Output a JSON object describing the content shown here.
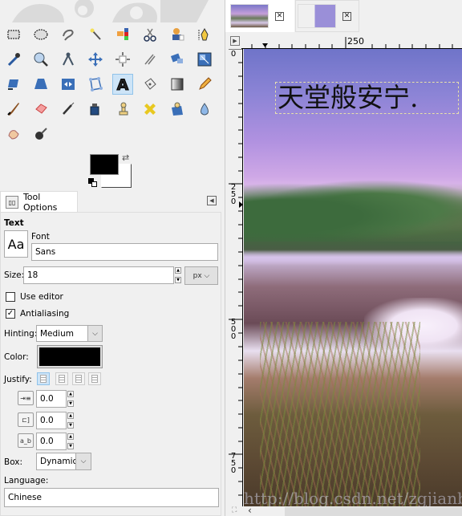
{
  "toolbox": {
    "tools": [
      {
        "name": "rect-select",
        "active": false
      },
      {
        "name": "ellipse-select",
        "active": false
      },
      {
        "name": "free-select",
        "active": false
      },
      {
        "name": "fuzzy-select",
        "active": false
      },
      {
        "name": "select-by-color",
        "active": false
      },
      {
        "name": "scissors-select",
        "active": false
      },
      {
        "name": "foreground-select",
        "active": false
      },
      {
        "name": "paths",
        "active": false
      },
      {
        "name": "color-picker",
        "active": false
      },
      {
        "name": "zoom",
        "active": false
      },
      {
        "name": "measure",
        "active": false
      },
      {
        "name": "move",
        "active": false
      },
      {
        "name": "alignment",
        "active": false
      },
      {
        "name": "crop",
        "active": false
      },
      {
        "name": "rotate",
        "active": false
      },
      {
        "name": "scale",
        "active": false
      },
      {
        "name": "shear",
        "active": false
      },
      {
        "name": "perspective",
        "active": false
      },
      {
        "name": "flip",
        "active": false
      },
      {
        "name": "cage-transform",
        "active": false
      },
      {
        "name": "text",
        "active": true
      },
      {
        "name": "bucket-fill",
        "active": false
      },
      {
        "name": "blend",
        "active": false
      },
      {
        "name": "pencil",
        "active": false
      },
      {
        "name": "paintbrush",
        "active": false
      },
      {
        "name": "eraser",
        "active": false
      },
      {
        "name": "airbrush",
        "active": false
      },
      {
        "name": "ink",
        "active": false
      },
      {
        "name": "clone",
        "active": false
      },
      {
        "name": "heal",
        "active": false
      },
      {
        "name": "perspective-clone",
        "active": false
      },
      {
        "name": "blur-sharpen",
        "active": false
      },
      {
        "name": "smudge",
        "active": false
      },
      {
        "name": "dodge-burn",
        "active": false
      }
    ],
    "foreground_color": "#000000",
    "background_color": "#ffffff"
  },
  "tool_options": {
    "tab_label": "Tool Options",
    "section_title": "Text",
    "font_label": "Font",
    "font_preview": "Aa",
    "font_value": "Sans",
    "size_label": "Size:",
    "size_value": "18",
    "size_unit": "px",
    "use_editor_label": "Use editor",
    "use_editor_checked": false,
    "antialiasing_label": "Antialiasing",
    "antialiasing_checked": true,
    "hinting_label": "Hinting:",
    "hinting_value": "Medium",
    "color_label": "Color:",
    "color_value": "#000000",
    "justify_label": "Justify:",
    "justify_selected": "left",
    "indent_value": "0.0",
    "line_spacing_value": "0.0",
    "letter_spacing_value": "0.0",
    "letter_spacing_icon": "a_b",
    "box_label": "Box:",
    "box_value": "Dynamic",
    "language_label": "Language:",
    "language_value": "Chinese"
  },
  "image_window": {
    "tabs": [
      {
        "name": "lake-image",
        "active": true
      },
      {
        "name": "screenshot-image",
        "active": false
      }
    ],
    "hruler_label": "250",
    "vruler_labels": [
      "0",
      "250",
      "500",
      "750"
    ],
    "text_layer_content": "天堂般安宁.",
    "watermark": "http://blog.csdn.net/zgjianbai"
  }
}
